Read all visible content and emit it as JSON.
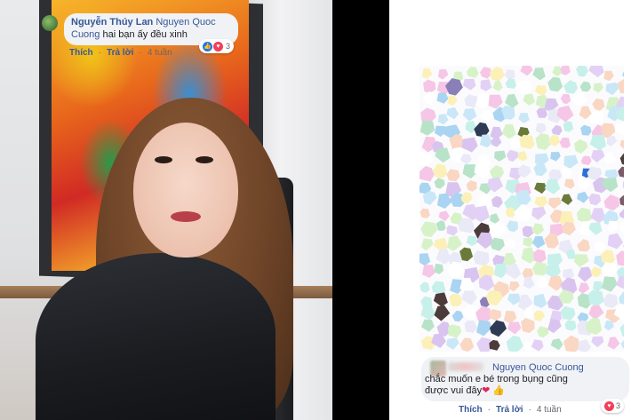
{
  "comment1": {
    "author": "Nguyễn Thúy Lan",
    "mention": "Nguyen Quoc Cuong",
    "text": "hai bạn ấy đều xinh",
    "reaction_count": "3",
    "actions": {
      "like": "Thích",
      "reply": "Trả lời",
      "time": "4 tuần"
    }
  },
  "comment2": {
    "mention": "Nguyen Quoc Cuong",
    "text_line1": "chắc muốn e bé trong bụng cũng",
    "text_line2": "được vui đây",
    "emoji_heart": "❤",
    "emoji_thumb": "👍",
    "reaction_count": "3",
    "actions": {
      "like": "Thích",
      "reply": "Trả lời",
      "time": "4 tuần"
    }
  },
  "icons": {
    "like": "like-reaction-icon",
    "love": "love-reaction-icon"
  },
  "colors": {
    "link": "#385898",
    "bubble": "#f0f2f5",
    "meta": "#65676b"
  }
}
